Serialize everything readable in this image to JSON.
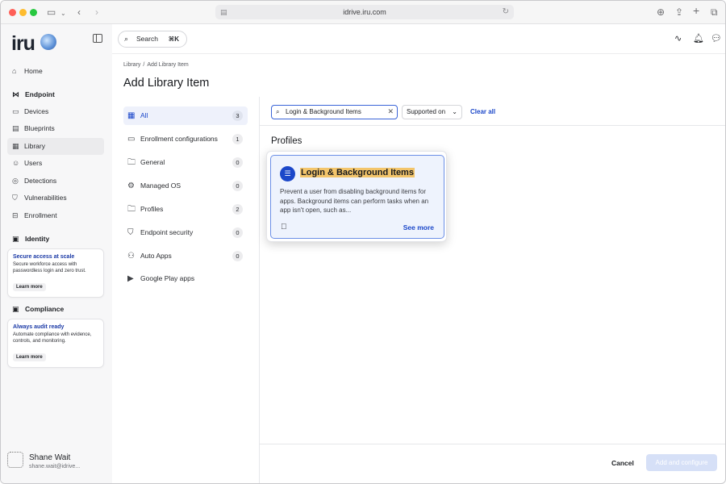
{
  "browser": {
    "url": "idrive.iru.com",
    "icons": [
      "sidebar-toggle-icon",
      "chevron-down-icon",
      "back-icon",
      "forward-icon",
      "download-icon",
      "share-icon",
      "new-tab-icon",
      "tabs-icon"
    ]
  },
  "sidebar": {
    "logo_text": "iru",
    "items": [
      {
        "label": "Home",
        "icon": "home-icon"
      },
      {
        "label": "Devices",
        "icon": "laptop-icon"
      },
      {
        "label": "Blueprints",
        "icon": "blueprint-icon"
      },
      {
        "label": "Library",
        "icon": "grid-icon"
      },
      {
        "label": "Users",
        "icon": "user-icon"
      },
      {
        "label": "Detections",
        "icon": "target-icon"
      },
      {
        "label": "Vulnerabilities",
        "icon": "shield-icon"
      },
      {
        "label": "Enrollment",
        "icon": "enroll-icon"
      }
    ],
    "sections": {
      "endpoint": "Endpoint",
      "identity": "Identity",
      "compliance": "Compliance"
    },
    "promos": [
      {
        "title": "Secure access at scale",
        "desc": "Secure workforce access with passwordless login and zero trust.",
        "button": "Learn more"
      },
      {
        "title": "Always audit ready",
        "desc": "Automate compliance with evidence, controls, and monitoring.",
        "button": "Learn more"
      }
    ],
    "user": {
      "name": "Shane Wait",
      "email": "shane.wait@idrive..."
    }
  },
  "topbar": {
    "search_label": "Search",
    "search_shortcut": "⌘K"
  },
  "header": {
    "breadcrumb": [
      "Library",
      "/",
      "Add Library Item"
    ],
    "title": "Add Library Item"
  },
  "categories": [
    {
      "label": "All",
      "count": "3"
    },
    {
      "label": "Enrollment configurations",
      "count": "1"
    },
    {
      "label": "General",
      "count": "0"
    },
    {
      "label": "Managed OS",
      "count": "0"
    },
    {
      "label": "Profiles",
      "count": "2"
    },
    {
      "label": "Endpoint security",
      "count": "0"
    },
    {
      "label": "Auto Apps",
      "count": "0"
    },
    {
      "label": "Google Play apps",
      "count": ""
    }
  ],
  "filters": {
    "search_value": "Login & Background Items",
    "supported_on": "Supported on",
    "clear_all": "Clear all"
  },
  "results": {
    "section_title": "Profiles",
    "card": {
      "title": "Login & Background Items",
      "description": "Prevent a user from disabling background items for apps. Background items can perform tasks when an app isn't open, such as...",
      "platform_icon": "apple-icon",
      "see_more": "See more"
    }
  },
  "footer": {
    "cancel": "Cancel",
    "add": "Add and configure"
  },
  "colors": {
    "accent": "#1b47c9",
    "highlight": "#f3c56b",
    "card_bg": "#eef3fd"
  }
}
